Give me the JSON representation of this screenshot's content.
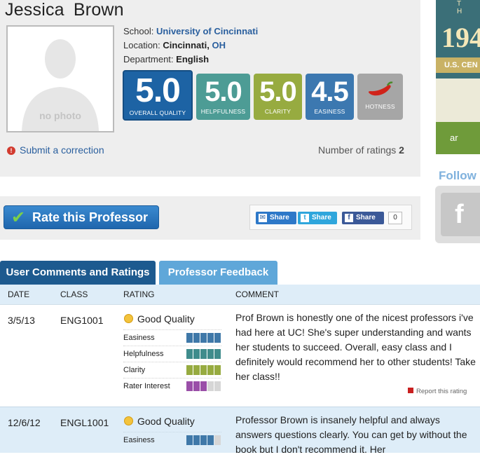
{
  "professor": {
    "first_name": "Jessica",
    "last_name": "Brown",
    "photo_label": "no photo",
    "school_label": "School:",
    "school": "University of Cincinnati",
    "location_label": "Location:",
    "city": "Cincinnati",
    "city_sep": ",",
    "state": "OH",
    "department_label": "Department:",
    "department": "English"
  },
  "scores": {
    "overall": {
      "value": "5.0",
      "label": "OVERALL QUALITY"
    },
    "helpfulness": {
      "value": "5.0",
      "label": "HELPFULNESS"
    },
    "clarity": {
      "value": "5.0",
      "label": "CLARITY"
    },
    "easiness": {
      "value": "4.5",
      "label": "EASINESS"
    },
    "hotness": {
      "label": "HOTNESS"
    }
  },
  "correction_link": "Submit a correction",
  "ratings_count_label": "Number of ratings",
  "ratings_count": "2",
  "rate_button": "Rate this Professor",
  "share": {
    "email": "Share",
    "twitter": "Share",
    "facebook": "Share",
    "count": "0"
  },
  "ad": {
    "top_text": "T H",
    "year": "194",
    "band": "U.S. CEN",
    "bottom": "ar"
  },
  "follow": "Follow",
  "tabs": {
    "comments": "User Comments and Ratings",
    "feedback": "Professor Feedback"
  },
  "table_headers": {
    "date": "DATE",
    "class": "CLASS",
    "rating": "RATING",
    "comment": "COMMENT"
  },
  "metric_labels": {
    "easiness": "Easiness",
    "helpfulness": "Helpfulness",
    "clarity": "Clarity",
    "interest": "Rater Interest"
  },
  "colors": {
    "easiness": "#3f78a8",
    "helpfulness": "#3f8c8c",
    "clarity": "#97ab40",
    "interest": "#9a4fa8"
  },
  "ratings": [
    {
      "date": "3/5/13",
      "class": "ENG1001",
      "quality": "Good Quality",
      "easiness": 5,
      "helpfulness": 5,
      "clarity": 5,
      "interest": 3,
      "comment": "Prof Brown is honestly one of the nicest professors i've had here at UC! She's super understanding and wants her students to succeed. Overall, easy class and I definitely would recommend her to other students! Take her class!!",
      "report": "Report this rating"
    },
    {
      "date": "12/6/12",
      "class": "ENGL1001",
      "quality": "Good Quality",
      "easiness": 4,
      "comment": "Professor Brown is insanely helpful and always answers questions clearly. You can get by without the book but I don't recommend it. Her"
    }
  ]
}
